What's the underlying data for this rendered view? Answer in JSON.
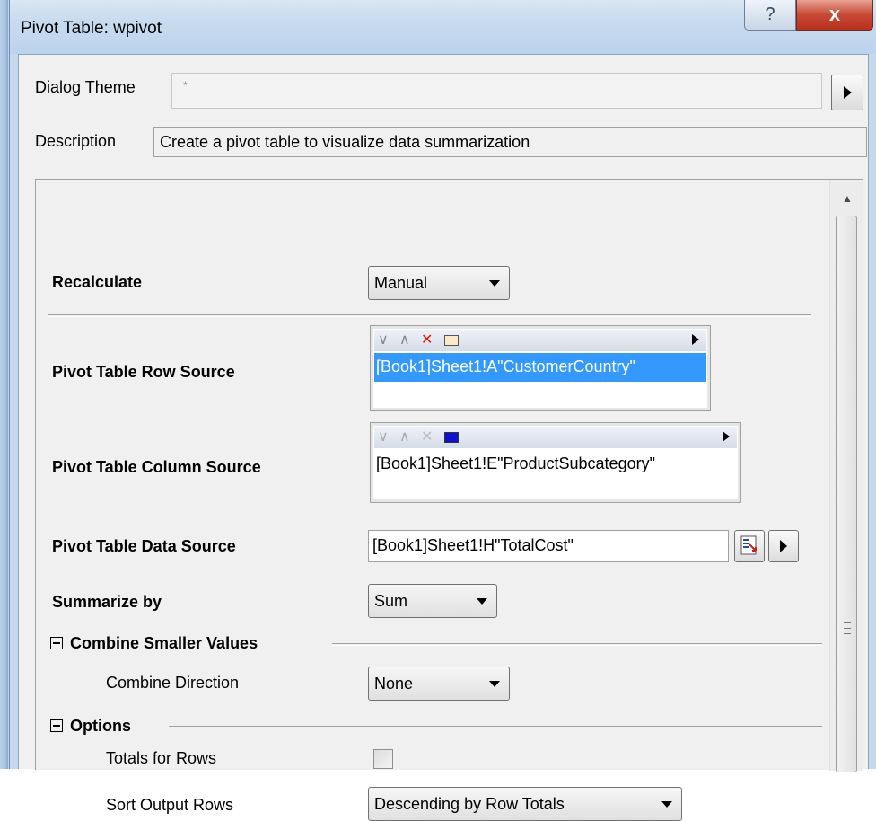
{
  "window": {
    "title": "Pivot Table: wpivot",
    "help_glyph": "?",
    "close_glyph": "x"
  },
  "header": {
    "dialog_theme_label": "Dialog Theme",
    "dialog_theme_value": "*",
    "description_label": "Description",
    "description_value": "Create a pivot table to visualize data summarization"
  },
  "form": {
    "recalculate": {
      "label": "Recalculate",
      "value": "Manual"
    },
    "row_source": {
      "label": "Pivot Table Row Source",
      "items": [
        "[Book1]Sheet1!A\"CustomerCountry\""
      ],
      "selected": true
    },
    "column_source": {
      "label": "Pivot Table Column Source",
      "items": [
        "[Book1]Sheet1!E\"ProductSubcategory\""
      ],
      "selected": false
    },
    "data_source": {
      "label": "Pivot Table Data Source",
      "value": "[Book1]Sheet1!H\"TotalCost\""
    },
    "summarize_by": {
      "label": "Summarize by",
      "value": "Sum"
    },
    "combine_section": {
      "label": "Combine Smaller Values",
      "combine_direction": {
        "label": "Combine Direction",
        "value": "None"
      }
    },
    "options_section": {
      "label": "Options",
      "totals_for_rows": {
        "label": "Totals for Rows",
        "checked": false
      },
      "sort_output_rows": {
        "label": "Sort Output Rows",
        "value": "Descending by Row Totals"
      }
    }
  },
  "toolbar_icons": [
    "move-down-icon",
    "move-up-icon",
    "delete-icon",
    "select-range-icon",
    "menu-arrow-icon"
  ],
  "colors": {
    "selection": "#3399ff",
    "delete_red": "#e81010",
    "accent_blue": "#1010d0",
    "close_red": "#c74a35"
  }
}
